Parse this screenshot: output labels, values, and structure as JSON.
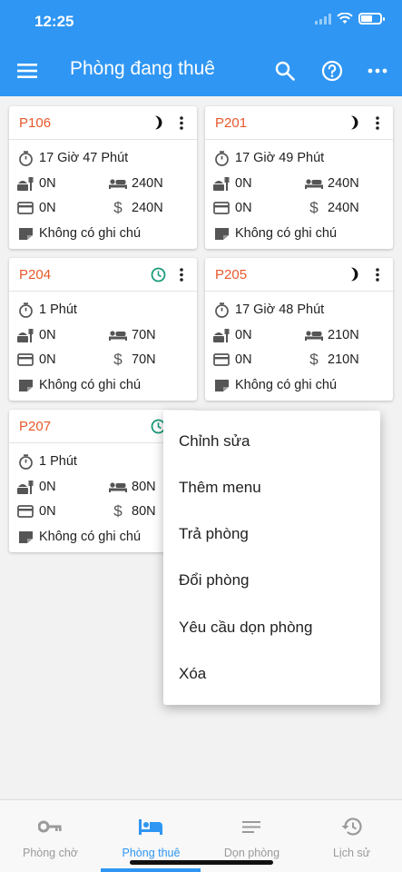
{
  "status": {
    "time": "12:25"
  },
  "appbar": {
    "title": "Phòng đang thuê"
  },
  "cards": [
    {
      "room": "P106",
      "state": "moon-icon",
      "duration": "17 Giờ 47 Phút",
      "food": "0N",
      "room_fee": "240N",
      "card": "0N",
      "total": "240N",
      "note": "Không có ghi chú"
    },
    {
      "room": "P201",
      "state": "moon-icon",
      "duration": "17 Giờ 49 Phút",
      "food": "0N",
      "room_fee": "240N",
      "card": "0N",
      "total": "240N",
      "note": "Không có ghi chú"
    },
    {
      "room": "P204",
      "state": "clock-icon",
      "duration": "1 Phút",
      "food": "0N",
      "room_fee": "70N",
      "card": "0N",
      "total": "70N",
      "note": "Không có ghi chú"
    },
    {
      "room": "P205",
      "state": "moon-icon",
      "duration": "17 Giờ 48 Phút",
      "food": "0N",
      "room_fee": "210N",
      "card": "0N",
      "total": "210N",
      "note": "Không có ghi chú"
    },
    {
      "room": "P207",
      "state": "clock-icon",
      "duration": "1 Phút",
      "food": "0N",
      "room_fee": "80N",
      "card": "0N",
      "total": "80N",
      "note": "Không có ghi chú"
    }
  ],
  "popup_menu": {
    "items": [
      "Chỉnh sửa",
      "Thêm menu",
      "Trả phòng",
      "Đổi phòng",
      "Yêu cầu dọn phòng",
      "Xóa"
    ]
  },
  "bottom_nav": {
    "tabs": [
      {
        "label": "Phòng chờ",
        "icon": "key-icon",
        "active": false
      },
      {
        "label": "Phòng thuê",
        "icon": "bed-icon",
        "active": true
      },
      {
        "label": "Dọn phòng",
        "icon": "list-icon",
        "active": false
      },
      {
        "label": "Lịch sử",
        "icon": "history-icon",
        "active": false
      }
    ]
  },
  "colors": {
    "primary": "#2f96f3",
    "room_label": "#e8582a",
    "clock_green": "#1a9a7a"
  }
}
